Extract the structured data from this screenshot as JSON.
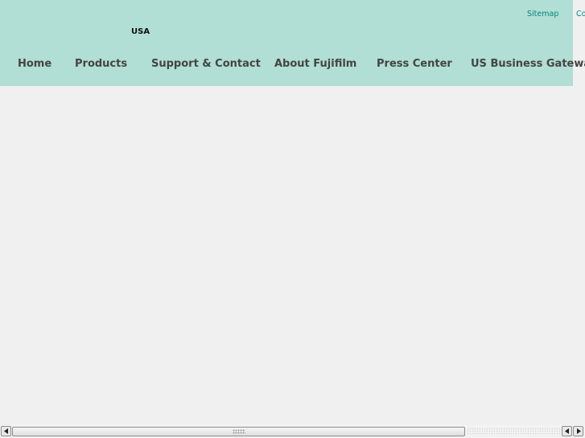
{
  "utility_links": [
    "Sitemap",
    "Co"
  ],
  "region": "USA",
  "nav": [
    "Home",
    "Products",
    "Support & Contact",
    "About Fujifilm",
    "Press Center",
    "US Business Gateway"
  ],
  "colors": {
    "header_bg": "#b1ded5",
    "page_bg": "#f0f0f0",
    "utility_link": "#00897b",
    "nav_text": "#444444"
  },
  "scrollbar": {
    "left_icon": "scroll-left-arrow-icon",
    "right_icon": "scroll-right-arrow-icon"
  }
}
